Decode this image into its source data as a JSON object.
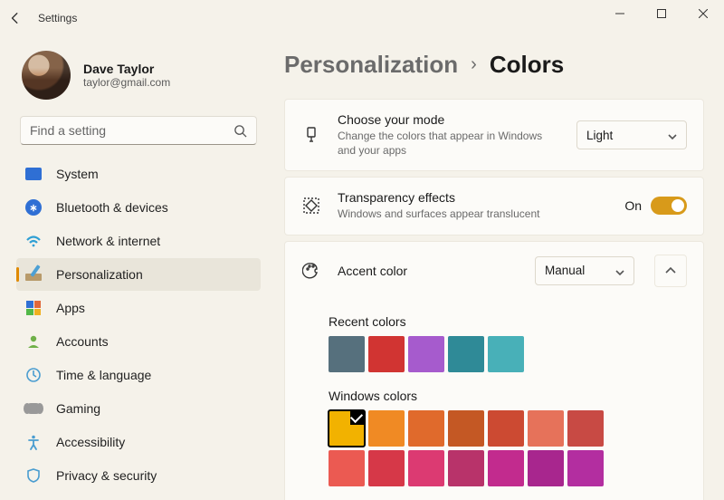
{
  "window": {
    "title": "Settings"
  },
  "profile": {
    "name": "Dave Taylor",
    "email": "taylor@gmail.com"
  },
  "search": {
    "placeholder": "Find a setting"
  },
  "nav": {
    "items": [
      {
        "label": "System"
      },
      {
        "label": "Bluetooth & devices"
      },
      {
        "label": "Network & internet"
      },
      {
        "label": "Personalization"
      },
      {
        "label": "Apps"
      },
      {
        "label": "Accounts"
      },
      {
        "label": "Time & language"
      },
      {
        "label": "Gaming"
      },
      {
        "label": "Accessibility"
      },
      {
        "label": "Privacy & security"
      }
    ]
  },
  "breadcrumb": {
    "parent": "Personalization",
    "current": "Colors"
  },
  "mode": {
    "title": "Choose your mode",
    "sub": "Change the colors that appear in Windows and your apps",
    "value": "Light"
  },
  "transparency": {
    "title": "Transparency effects",
    "sub": "Windows and surfaces appear translucent",
    "state_label": "On"
  },
  "accent": {
    "title": "Accent color",
    "mode": "Manual",
    "recent_label": "Recent colors",
    "recent_colors": [
      "#56707d",
      "#d13432",
      "#a65bcd",
      "#2f8a97",
      "#48b0b8"
    ],
    "windows_label": "Windows colors",
    "windows_colors_row1": [
      "#f2b200",
      "#f08a24",
      "#e06a2c",
      "#c45824",
      "#cc4a32",
      "#e6725a",
      "#c84a44"
    ],
    "windows_colors_row2": [
      "#eb5a52",
      "#d63848",
      "#dc3a72",
      "#b8336a",
      "#c22b8e",
      "#a8268e",
      "#b32ea0"
    ],
    "selected_index": 0
  }
}
